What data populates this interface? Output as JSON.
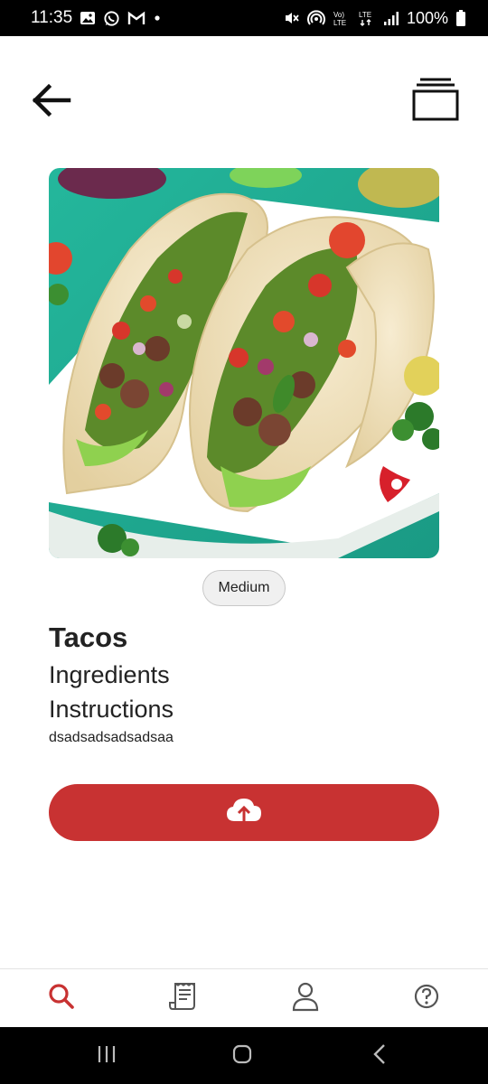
{
  "status_bar": {
    "time": "11:35",
    "battery": "100%",
    "icons_left": [
      "gallery-icon",
      "whatsapp-icon",
      "gmail-icon",
      "dot-icon"
    ],
    "icons_right": [
      "mute-icon",
      "hotspot-icon",
      "volte-icon",
      "lte-icon",
      "signal-icon",
      "battery-icon"
    ]
  },
  "app_bar": {
    "back_icon": "arrow-left-icon",
    "collection_icon": "collection-icon"
  },
  "recipe": {
    "image_alt": "tacos-photo",
    "difficulty": "Medium",
    "title": "Tacos",
    "ingredients_heading": "Ingredients",
    "instructions_heading": "Instructions",
    "instructions_text": "dsadsadsadsadsaa"
  },
  "actions": {
    "upload_icon": "cloud-upload-icon"
  },
  "bottom_nav": {
    "items": [
      {
        "icon": "search-icon",
        "active": true
      },
      {
        "icon": "recipe-list-icon",
        "active": false
      },
      {
        "icon": "profile-icon",
        "active": false
      },
      {
        "icon": "help-icon",
        "active": false
      }
    ]
  },
  "colors": {
    "accent": "#c83232",
    "nav_inactive": "#555555"
  }
}
